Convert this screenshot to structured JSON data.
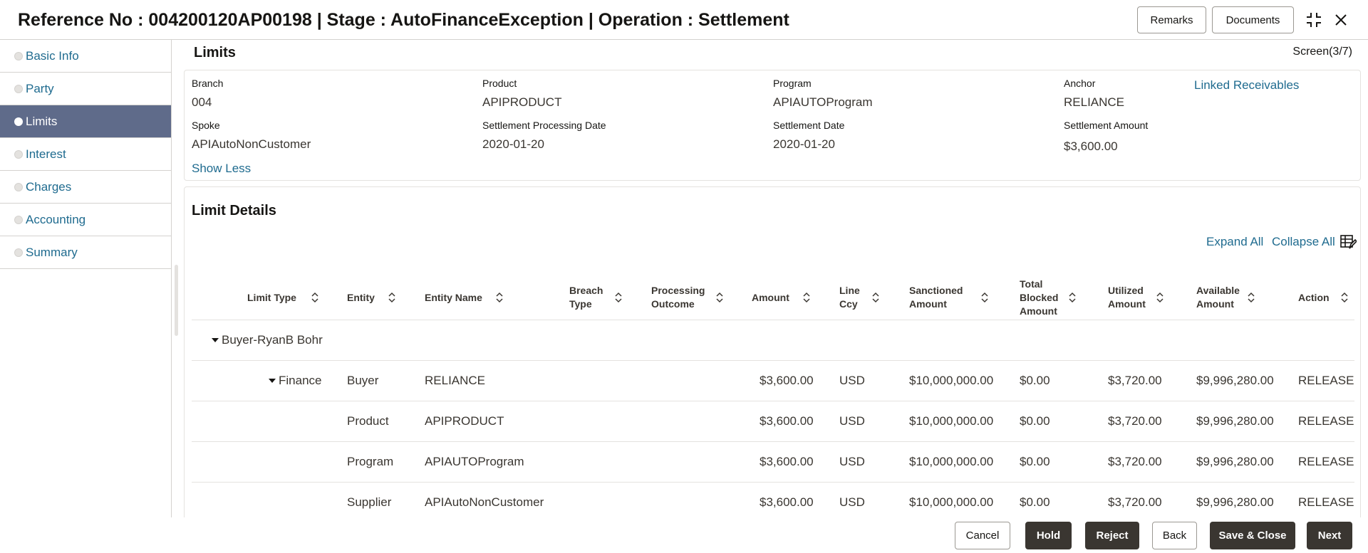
{
  "header": {
    "title": "Reference No : 004200120AP00198 | Stage : AutoFinanceException | Operation : Settlement",
    "remarks_label": "Remarks",
    "documents_label": "Documents"
  },
  "sidebar": {
    "items": [
      {
        "label": "Basic Info"
      },
      {
        "label": "Party"
      },
      {
        "label": "Limits"
      },
      {
        "label": "Interest"
      },
      {
        "label": "Charges"
      },
      {
        "label": "Accounting"
      },
      {
        "label": "Summary"
      }
    ],
    "active": "Limits"
  },
  "limits": {
    "title": "Limits",
    "screen": "Screen(3/7)",
    "fields": {
      "branch_label": "Branch",
      "branch": "004",
      "product_label": "Product",
      "product": "APIPRODUCT",
      "program_label": "Program",
      "program": "APIAUTOProgram",
      "anchor_label": "Anchor",
      "anchor": "RELIANCE",
      "spoke_label": "Spoke",
      "spoke": "APIAutoNonCustomer",
      "spd_label": "Settlement Processing Date",
      "spd": "2020-01-20",
      "sd_label": "Settlement Date",
      "sd": "2020-01-20",
      "sa_label": "Settlement Amount",
      "sa": "$3,600.00"
    },
    "linked_receivables": "Linked Receivables",
    "show_less": "Show Less"
  },
  "limit_details": {
    "title": "Limit Details",
    "expand_all": "Expand All",
    "collapse_all": "Collapse All",
    "columns": {
      "limit_type": "Limit Type",
      "entity": "Entity",
      "entity_name": "Entity Name",
      "breach_type": "Breach Type",
      "processing_outcome": "Processing Outcome",
      "amount": "Amount",
      "line_ccy": "Line Ccy",
      "sanctioned_amount": "Sanctioned Amount",
      "total_blocked_amount": "Total Blocked Amount",
      "utilized_amount": "Utilized Amount",
      "available_amount": "Available Amount",
      "action": "Action"
    },
    "group_label": "Buyer-RyanB Bohr",
    "subgroup_label": "Finance",
    "rows": [
      {
        "entity": "Buyer",
        "entity_name": "RELIANCE",
        "amount": "$3,600.00",
        "ccy": "USD",
        "sanctioned": "$10,000,000.00",
        "blocked": "$0.00",
        "utilized": "$3,720.00",
        "available": "$9,996,280.00",
        "action": "RELEASE"
      },
      {
        "entity": "Product",
        "entity_name": "APIPRODUCT",
        "amount": "$3,600.00",
        "ccy": "USD",
        "sanctioned": "$10,000,000.00",
        "blocked": "$0.00",
        "utilized": "$3,720.00",
        "available": "$9,996,280.00",
        "action": "RELEASE"
      },
      {
        "entity": "Program",
        "entity_name": "APIAUTOProgram",
        "amount": "$3,600.00",
        "ccy": "USD",
        "sanctioned": "$10,000,000.00",
        "blocked": "$0.00",
        "utilized": "$3,720.00",
        "available": "$9,996,280.00",
        "action": "RELEASE"
      },
      {
        "entity": "Supplier",
        "entity_name": "APIAutoNonCustomer",
        "amount": "$3,600.00",
        "ccy": "USD",
        "sanctioned": "$10,000,000.00",
        "blocked": "$0.00",
        "utilized": "$3,720.00",
        "available": "$9,996,280.00",
        "action": "RELEASE"
      }
    ]
  },
  "footer": {
    "cancel": "Cancel",
    "hold": "Hold",
    "reject": "Reject",
    "back": "Back",
    "save_close": "Save & Close",
    "next": "Next"
  },
  "colors": {
    "accent_link": "#1f6b8f",
    "active_nav": "#5f6b8a",
    "dark_button": "#3a3631"
  }
}
